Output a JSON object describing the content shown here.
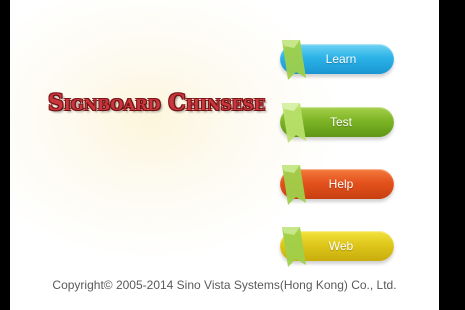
{
  "app": {
    "title": "Signboard Chinsese"
  },
  "menu": [
    {
      "id": "learn",
      "label": "Learn",
      "color": "#2cb3e8"
    },
    {
      "id": "test",
      "label": "Test",
      "color": "#7eb526"
    },
    {
      "id": "help",
      "label": "Help",
      "color": "#e4521d"
    },
    {
      "id": "web",
      "label": "Web",
      "color": "#dfc71b"
    }
  ],
  "ribbon_color": "#9fd04a",
  "footer": {
    "copyright": "Copyright© 2005-2014 Sino Vista Systems(Hong Kong) Co., Ltd."
  }
}
